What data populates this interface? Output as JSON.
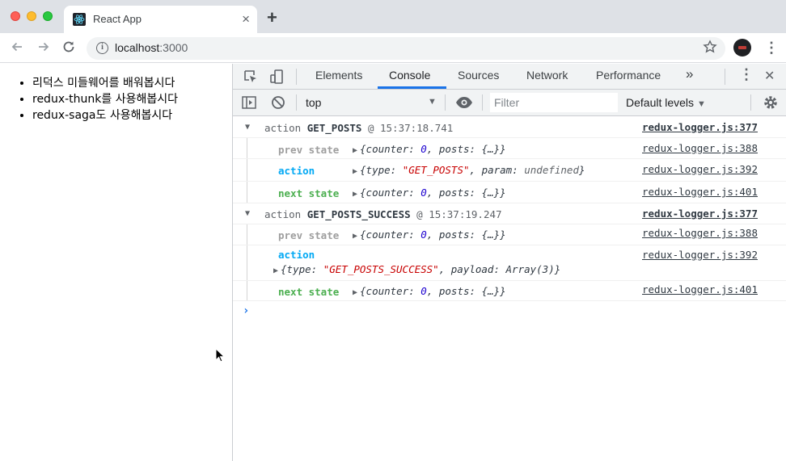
{
  "browser": {
    "tab_title": "React App",
    "tab_close": "×",
    "new_tab": "+",
    "url_host": "localhost",
    "url_port": ":3000",
    "info_glyph": "i",
    "back_icon": "arrow-left",
    "forward_icon": "arrow-right",
    "reload_icon": "reload"
  },
  "page": {
    "items": [
      "리덕스 미들웨어를 배워봅시다",
      "redux-thunk를 사용해봅시다",
      "redux-saga도 사용해봅시다"
    ]
  },
  "devtools": {
    "tabs": [
      "Elements",
      "Console",
      "Sources",
      "Network",
      "Performance"
    ],
    "active_tab": "Console",
    "more_tabs": "»",
    "context": "top",
    "filter_placeholder": "Filter",
    "levels": "Default levels",
    "levels_arrow": "▼",
    "ctx_arrow": "▼",
    "close": "✕",
    "kebab": "⋮"
  },
  "console": {
    "groups": [
      {
        "prefix": "action",
        "type": "GET_POSTS",
        "time": "@ 15:37:18.741",
        "src": "redux-logger.js:377",
        "prev": {
          "label": "prev state",
          "src": "redux-logger.js:388",
          "obj_open": "{counter: ",
          "counter": "0",
          "obj_rest": ", posts: {…}}"
        },
        "action": {
          "label": "action",
          "src": "redux-logger.js:392",
          "obj_open": "{type: ",
          "type_str": "\"GET_POSTS\"",
          "obj_mid": ", param: ",
          "param": "undefined",
          "obj_close": "}"
        },
        "next": {
          "label": "next state",
          "src": "redux-logger.js:401",
          "obj_open": "{counter: ",
          "counter": "0",
          "obj_rest": ", posts: {…}}"
        }
      },
      {
        "prefix": "action",
        "type": "GET_POSTS_SUCCESS",
        "time": "@ 15:37:19.247",
        "src": "redux-logger.js:377",
        "prev": {
          "label": "prev state",
          "src": "redux-logger.js:388",
          "obj_open": "{counter: ",
          "counter": "0",
          "obj_rest": ", posts: {…}}"
        },
        "action": {
          "label": "action",
          "src": "redux-logger.js:392",
          "obj_open": "{type: ",
          "type_str": "\"GET_POSTS_SUCCESS\"",
          "obj_mid": ", payload: ",
          "payload": "Array(3)",
          "obj_close": "}"
        },
        "next": {
          "label": "next state",
          "src": "redux-logger.js:401",
          "obj_open": "{counter: ",
          "counter": "0",
          "obj_rest": ", posts: {…}}"
        }
      }
    ],
    "prompt": "›"
  },
  "colors": {
    "prev_state": "#9e9e9e",
    "action": "#03a9f4",
    "next_state": "#4caf50",
    "string": "#c80000",
    "number": "#1c00cf",
    "active_tab_underline": "#1a73e8"
  }
}
